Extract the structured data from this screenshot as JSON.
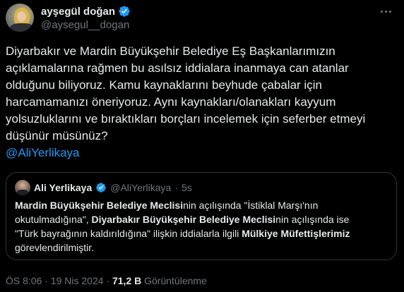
{
  "tweet": {
    "author": {
      "display_name": "ayşegül doğan",
      "handle": "@aysegul__dogan"
    },
    "text_lines": [
      "Diyarbakır ve Mardin Büyükşehir Belediye Eş Başkanlarımızın",
      "açıklamalarına rağmen bu asılsız iddialara inanmaya can atanlar",
      "olduğunu biliyoruz. Kamu kaynaklarını beyhude çabalar için",
      "harcamamanızı öneriyoruz. Aynı kaynakları/olanakları kayyum",
      "yolsuzluklarını ve bıraktıkları borçları incelemek için seferber etmeyi",
      "düşünür müsünüz?"
    ],
    "mention": "@AliYerlikaya",
    "timestamp": "ÖS 8:06 · 19 Nis 2024",
    "separator": "·",
    "views_count": "71,2 B",
    "views_label": "Görüntülenme"
  },
  "quoted_tweet": {
    "display_name": "Ali Yerlikaya",
    "handle": "@AliYerlikaya",
    "dot": "·",
    "time": "5s",
    "lines": [
      [
        {
          "t": "Mardin Büyükşehir Belediye Meclisi",
          "b": true
        },
        {
          "t": "nin açılışında \"İstiklal Marşı'nın",
          "b": false
        }
      ],
      [
        {
          "t": "okutulmadığına\", ",
          "b": false
        },
        {
          "t": "Diyarbakır Büyükşehir Belediye Meclisi",
          "b": true
        },
        {
          "t": "nin açılışında ise",
          "b": false
        }
      ],
      [
        {
          "t": "\"Türk bayrağının kaldırıldığına\" ilişkin iddialarla ilgili ",
          "b": false
        },
        {
          "t": "Mülkiye Müfettişlerimiz",
          "b": true
        }
      ],
      [
        {
          "t": "görevlendirilmiştir.",
          "b": false
        }
      ]
    ]
  },
  "colors": {
    "background": "#000000",
    "text": "#e7e9ea",
    "muted": "#71767b",
    "link": "#1d9bf0",
    "border": "#2f3336",
    "verified_badge": "#1d9bf0"
  },
  "icons": {
    "verified": "verified-badge-icon",
    "more": "more-options-icon"
  }
}
